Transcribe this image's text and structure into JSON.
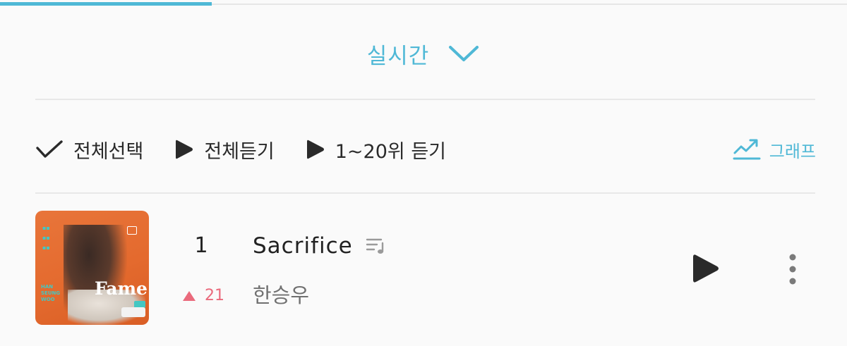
{
  "tabs": {
    "active_index": 0
  },
  "period": {
    "label": "실시간",
    "icon": "chevron-down-icon"
  },
  "toolbar": {
    "select_all": {
      "label": "전체선택",
      "icon": "check-icon"
    },
    "play_all": {
      "label": "전체듣기",
      "icon": "play-icon"
    },
    "play_top20": {
      "label": "1~20위 듣기",
      "icon": "play-icon"
    },
    "graph": {
      "label": "그래프",
      "icon": "trending-up-icon"
    }
  },
  "chart": {
    "rows": [
      {
        "rank": "1",
        "change": "21",
        "change_direction": "up",
        "title": "Sacrifice",
        "artist": "한승우",
        "album_art_text": "Fame",
        "album_art_artist_text": "HAN SEUNG WOO"
      }
    ]
  },
  "colors": {
    "accent": "#4fb8d6",
    "rank_up": "#ea6a7c",
    "text_primary": "#222222",
    "text_secondary": "#707070",
    "background": "#fafafa"
  }
}
